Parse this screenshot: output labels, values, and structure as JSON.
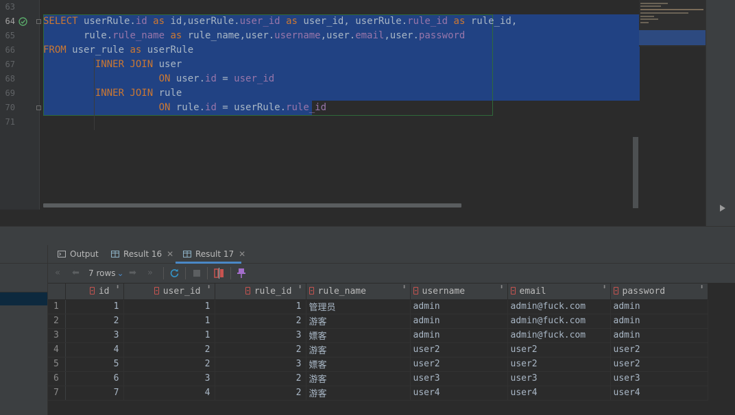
{
  "editor": {
    "line_numbers": [
      "63",
      "64",
      "65",
      "66",
      "67",
      "68",
      "69",
      "70",
      "71"
    ],
    "current_line": "64",
    "lines": [
      {
        "num": "63",
        "tokens": []
      },
      {
        "num": "64",
        "tokens": [
          {
            "t": "SELECT",
            "c": "kw"
          },
          {
            "t": " userRule.",
            "c": ""
          },
          {
            "t": "id",
            "c": "fld"
          },
          {
            "t": " ",
            "c": ""
          },
          {
            "t": "as",
            "c": "kw"
          },
          {
            "t": " id,userRule.",
            "c": ""
          },
          {
            "t": "user_id",
            "c": "fld"
          },
          {
            "t": " ",
            "c": ""
          },
          {
            "t": "as",
            "c": "kw"
          },
          {
            "t": " user_id, userRule.",
            "c": ""
          },
          {
            "t": "rule_id",
            "c": "fld"
          },
          {
            "t": " ",
            "c": ""
          },
          {
            "t": "as",
            "c": "kw"
          },
          {
            "t": " rule_id,",
            "c": ""
          }
        ]
      },
      {
        "num": "65",
        "tokens": [
          {
            "t": "       rule.",
            "c": ""
          },
          {
            "t": "rule_name",
            "c": "fld"
          },
          {
            "t": " ",
            "c": ""
          },
          {
            "t": "as",
            "c": "kw"
          },
          {
            "t": " rule_name,user.",
            "c": ""
          },
          {
            "t": "username",
            "c": "fld"
          },
          {
            "t": ",user.",
            "c": ""
          },
          {
            "t": "email",
            "c": "fld"
          },
          {
            "t": ",user.",
            "c": ""
          },
          {
            "t": "password",
            "c": "fld"
          }
        ]
      },
      {
        "num": "66",
        "tokens": [
          {
            "t": "FROM",
            "c": "kw"
          },
          {
            "t": " user_rule ",
            "c": ""
          },
          {
            "t": "as",
            "c": "kw"
          },
          {
            "t": " userRule",
            "c": ""
          }
        ]
      },
      {
        "num": "67",
        "tokens": [
          {
            "t": "         ",
            "c": ""
          },
          {
            "t": "INNER JOIN",
            "c": "kw"
          },
          {
            "t": " user",
            "c": ""
          }
        ]
      },
      {
        "num": "68",
        "tokens": [
          {
            "t": "                    ",
            "c": ""
          },
          {
            "t": "ON",
            "c": "kw"
          },
          {
            "t": " user.",
            "c": ""
          },
          {
            "t": "id",
            "c": "fld"
          },
          {
            "t": " = ",
            "c": ""
          },
          {
            "t": "user_id",
            "c": "fld"
          }
        ]
      },
      {
        "num": "69",
        "tokens": [
          {
            "t": "         ",
            "c": ""
          },
          {
            "t": "INNER JOIN",
            "c": "kw"
          },
          {
            "t": " rule",
            "c": ""
          }
        ]
      },
      {
        "num": "70",
        "tokens": [
          {
            "t": "                    ",
            "c": ""
          },
          {
            "t": "ON",
            "c": "kw"
          },
          {
            "t": " rule.",
            "c": ""
          },
          {
            "t": "id",
            "c": "fld"
          },
          {
            "t": " = userRule.",
            "c": ""
          },
          {
            "t": "rule_id",
            "c": "fld"
          }
        ]
      },
      {
        "num": "71",
        "tokens": []
      }
    ]
  },
  "tabs": [
    {
      "label": "Output",
      "icon": "console-icon"
    },
    {
      "label": "Result 16",
      "icon": "table-icon",
      "closable": true
    },
    {
      "label": "Result 17",
      "icon": "table-icon",
      "closable": true,
      "active": true
    }
  ],
  "toolbar": {
    "rows_label": "7 rows",
    "buttons": [
      "first-page-icon",
      "prev-page-icon",
      "next-page-icon",
      "last-page-icon",
      "refresh-icon",
      "stop-icon",
      "compare-icon",
      "pin-icon"
    ]
  },
  "grid": {
    "columns": [
      {
        "name": "id",
        "numeric": true
      },
      {
        "name": "user_id",
        "numeric": true
      },
      {
        "name": "rule_id",
        "numeric": true
      },
      {
        "name": "rule_name",
        "numeric": false
      },
      {
        "name": "username",
        "numeric": false
      },
      {
        "name": "email",
        "numeric": false
      },
      {
        "name": "password",
        "numeric": false
      }
    ],
    "rows": [
      {
        "n": "1",
        "cells": [
          "1",
          "1",
          "1",
          "管理员",
          "admin",
          "admin@fuck.com",
          "admin"
        ]
      },
      {
        "n": "2",
        "cells": [
          "2",
          "1",
          "2",
          "游客",
          "admin",
          "admin@fuck.com",
          "admin"
        ]
      },
      {
        "n": "3",
        "cells": [
          "3",
          "1",
          "3",
          "嫖客",
          "admin",
          "admin@fuck.com",
          "admin"
        ]
      },
      {
        "n": "4",
        "cells": [
          "4",
          "2",
          "2",
          "游客",
          "user2",
          "user2",
          "user2"
        ]
      },
      {
        "n": "5",
        "cells": [
          "5",
          "2",
          "3",
          "嫖客",
          "user2",
          "user2",
          "user2"
        ]
      },
      {
        "n": "6",
        "cells": [
          "6",
          "3",
          "2",
          "游客",
          "user3",
          "user3",
          "user3"
        ]
      },
      {
        "n": "7",
        "cells": [
          "7",
          "4",
          "2",
          "游客",
          "user4",
          "user4",
          "user4"
        ]
      }
    ]
  },
  "colors": {
    "keyword": "#cc7832",
    "field": "#9876aa",
    "identifier": "#a9b7c6",
    "selection": "#214283",
    "accent": "#4a88c7",
    "refresh_icon": "#3592c4",
    "compare_icon": "#c75450",
    "pin_icon": "#a46ecb"
  }
}
